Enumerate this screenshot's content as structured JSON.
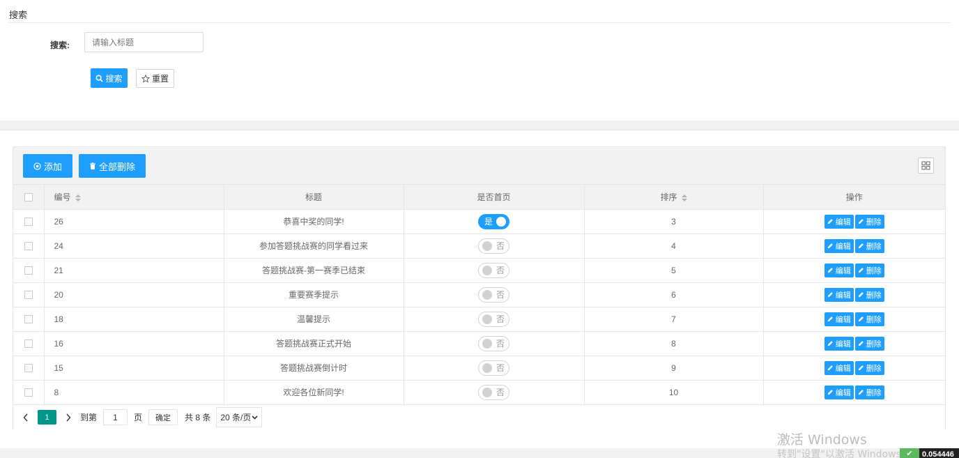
{
  "search_panel": {
    "title": "搜索",
    "field_label": "搜索:",
    "input_placeholder": "请输入标题",
    "input_value": "",
    "search_button": "搜索",
    "reset_button": "重置"
  },
  "toolbar": {
    "add_button": "添加",
    "delete_all_button": "全部删除",
    "columns_icon": "grid-columns-icon"
  },
  "table": {
    "headers": {
      "id": "编号",
      "title": "标题",
      "is_home": "是否首页",
      "sort": "排序",
      "actions": "操作"
    },
    "switch_on_text": "是",
    "switch_off_text": "否",
    "edit_label": "编辑",
    "delete_label": "删除",
    "rows": [
      {
        "id": "26",
        "title": "恭喜中奖的同学!",
        "is_home": true,
        "sort": "3"
      },
      {
        "id": "24",
        "title": "参加答题挑战赛的同学看过来",
        "is_home": false,
        "sort": "4"
      },
      {
        "id": "21",
        "title": "答题挑战赛-第一赛季已结束",
        "is_home": false,
        "sort": "5"
      },
      {
        "id": "20",
        "title": "重要赛季提示",
        "is_home": false,
        "sort": "6"
      },
      {
        "id": "18",
        "title": "温馨提示",
        "is_home": false,
        "sort": "7"
      },
      {
        "id": "16",
        "title": "答题挑战赛正式开始",
        "is_home": false,
        "sort": "8"
      },
      {
        "id": "15",
        "title": "答题挑战赛倒计时",
        "is_home": false,
        "sort": "9"
      },
      {
        "id": "8",
        "title": "欢迎各位新同学!",
        "is_home": false,
        "sort": "10"
      }
    ]
  },
  "pagination": {
    "current_page": "1",
    "goto_label": "到第",
    "goto_value": "1",
    "page_unit": "页",
    "confirm_button": "确定",
    "total_text": "共 8 条",
    "page_size": "20 条/页"
  },
  "watermark": {
    "line1": "激活 Windows",
    "line2": "转到\"设置\"以激活 Windows"
  },
  "tray": {
    "value": "0.054446"
  },
  "colors": {
    "primary": "#1e9fff",
    "pager_active": "#009688"
  }
}
